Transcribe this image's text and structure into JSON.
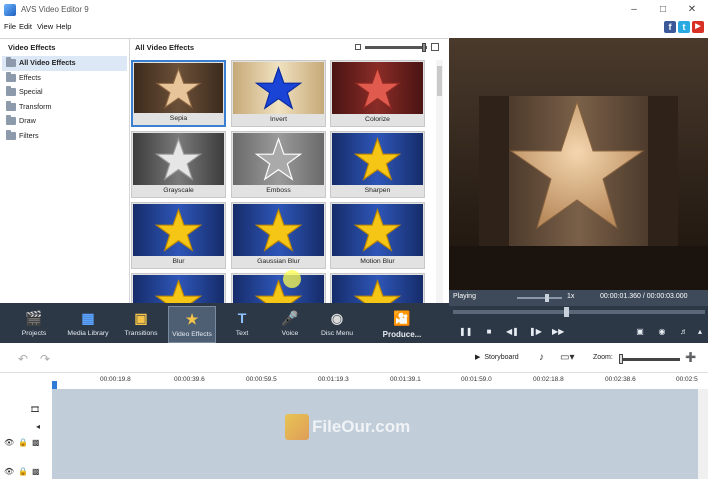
{
  "window": {
    "title": "AVS Video Editor 9"
  },
  "menu": [
    "File",
    "Edit",
    "View",
    "Help"
  ],
  "effects_panel": {
    "categories_title": "Video Effects",
    "grid_title": "All Video Effects",
    "categories": [
      {
        "label": "All Video Effects",
        "selected": true
      },
      {
        "label": "Effects",
        "selected": false
      },
      {
        "label": "Special",
        "selected": false
      },
      {
        "label": "Transform",
        "selected": false
      },
      {
        "label": "Draw",
        "selected": false
      },
      {
        "label": "Filters",
        "selected": false
      }
    ],
    "effects": [
      {
        "label": "Sepia"
      },
      {
        "label": "Invert"
      },
      {
        "label": "Colorize"
      },
      {
        "label": "Grayscale"
      },
      {
        "label": "Emboss"
      },
      {
        "label": "Sharpen"
      },
      {
        "label": "Blur"
      },
      {
        "label": "Gaussian Blur"
      },
      {
        "label": "Motion Blur"
      },
      {
        "label": ""
      },
      {
        "label": ""
      },
      {
        "label": ""
      }
    ]
  },
  "playback": {
    "status": "Playing",
    "speed": "1x",
    "timecode": "00:00:01.360 / 00:00:03.000"
  },
  "toolbar": {
    "items": [
      {
        "label": "Projects",
        "active": false
      },
      {
        "label": "Media Library",
        "active": false
      },
      {
        "label": "Transitions",
        "active": false
      },
      {
        "label": "Video Effects",
        "active": true
      },
      {
        "label": "Text",
        "active": false
      },
      {
        "label": "Voice",
        "active": false
      },
      {
        "label": "Disc Menu",
        "active": false
      },
      {
        "label": "Produce...",
        "active": false
      }
    ]
  },
  "timeline": {
    "storyboard_label": "Storyboard",
    "zoom_label": "Zoom:",
    "ruler": [
      "00:00:19.8",
      "00:00:39.6",
      "00:00:59.5",
      "00:01:19.3",
      "00:01:39.1",
      "00:01:59.0",
      "00:02:18.8",
      "00:02:38.6",
      "00:02:5"
    ]
  },
  "watermark": "FileOur.com"
}
